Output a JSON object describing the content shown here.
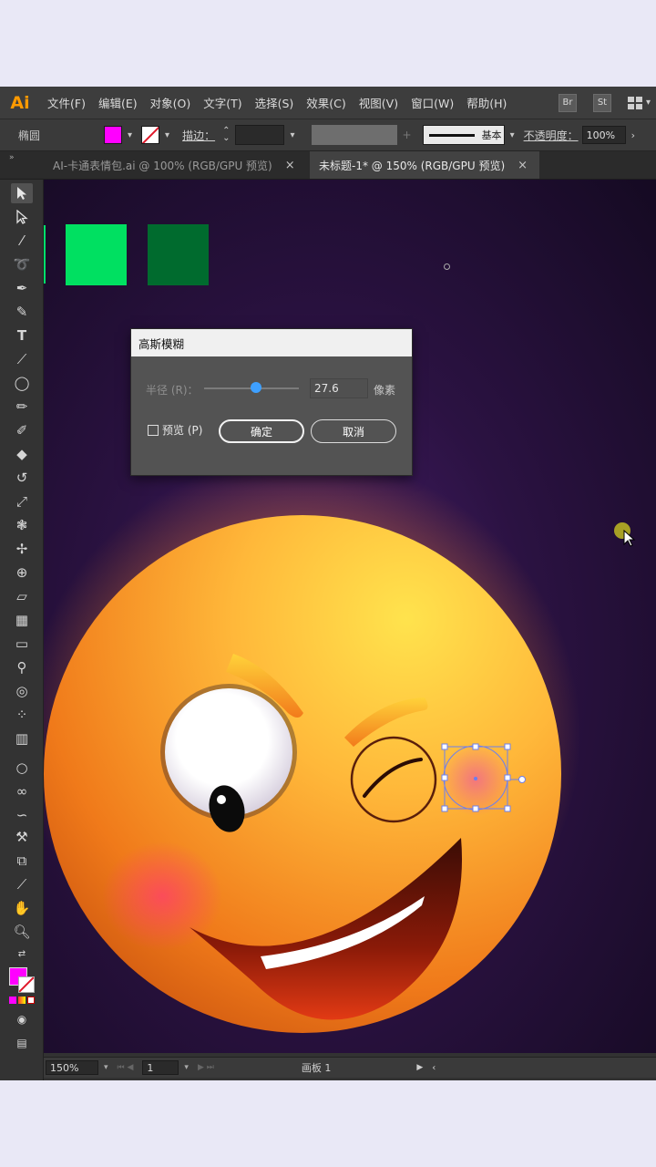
{
  "app": {
    "logo": "Ai",
    "menu": [
      "文件(F)",
      "编辑(E)",
      "对象(O)",
      "文字(T)",
      "选择(S)",
      "效果(C)",
      "视图(V)",
      "窗口(W)",
      "帮助(H)"
    ],
    "bridge": "Br",
    "stock": "St"
  },
  "control_bar": {
    "object_label": "椭圆",
    "fill_color": "#ff00ff",
    "stroke_label": "描边：",
    "line_style_label": "基本",
    "opacity_label": "不透明度：",
    "opacity_value": "100%"
  },
  "tabs": [
    {
      "label": "AI-卡通表情包.ai @ 100% (RGB/GPU 预览)",
      "active": false
    },
    {
      "label": "未标题-1* @ 150% (RGB/GPU 预览)",
      "active": true
    }
  ],
  "dialog": {
    "title": "高斯模糊",
    "radius_label": "半径 (R)：",
    "radius_value": "27.6",
    "radius_fraction": 0.55,
    "unit": "像素",
    "preview_label": "预览 (P)",
    "preview_checked": false,
    "ok_label": "确定",
    "cancel_label": "取消"
  },
  "canvas": {
    "swatch_green_light": "#00e061",
    "swatch_green_dark": "#006b2e"
  },
  "status_bar": {
    "zoom": "150%",
    "page": "1",
    "artboard_label": "画板",
    "artboard_number": "1"
  },
  "tools": [
    "selection-tool",
    "direct-selection-tool",
    "magic-wand-tool",
    "lasso-tool",
    "pen-tool",
    "curvature-tool",
    "type-tool",
    "line-tool",
    "ellipse-tool",
    "paintbrush-tool",
    "shaper-tool",
    "eraser-tool",
    "rotate-tool",
    "scale-tool",
    "warp-tool",
    "puppet-warp-tool",
    "shape-builder-tool",
    "perspective-tool",
    "mesh-tool",
    "gradient-tool",
    "eyedropper-tool",
    "blend-tool",
    "symbol-sprayer-tool",
    "graph-tool",
    "artboard-tool",
    "slice-tool",
    "eraser-tool-2",
    "hand-tool",
    "zoom-tool"
  ]
}
